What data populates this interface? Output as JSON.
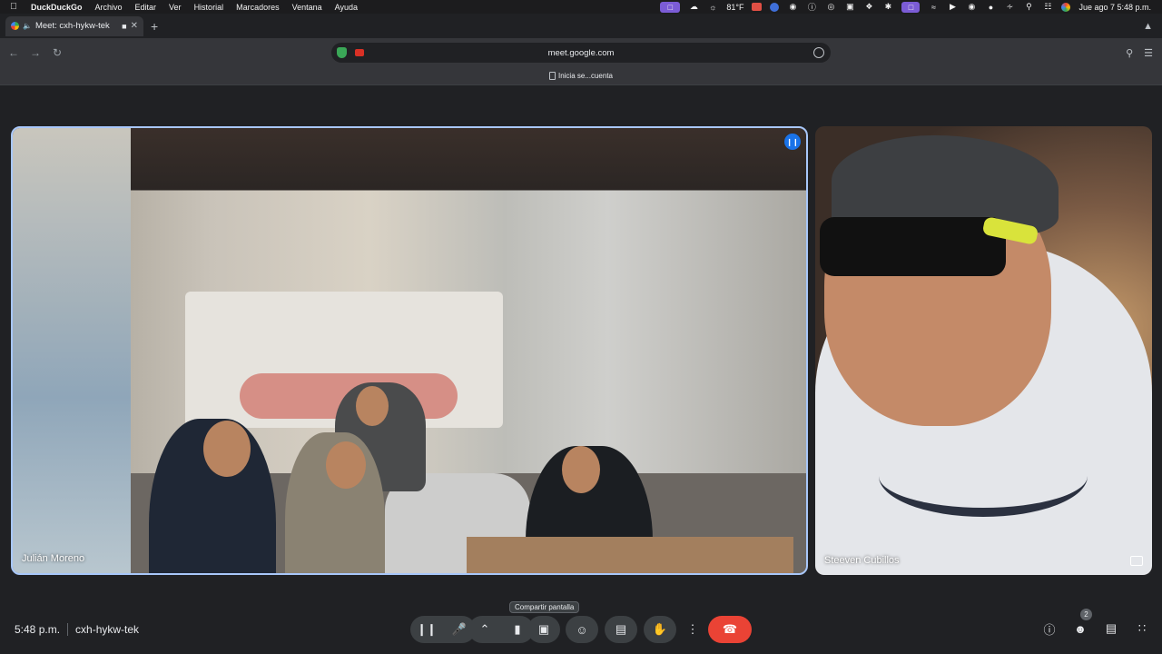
{
  "menubar": {
    "app": "DuckDuckGo",
    "items": [
      "Archivo",
      "Editar",
      "Ver",
      "Historial",
      "Marcadores",
      "Ventana",
      "Ayuda"
    ],
    "temperature": "81°F",
    "clock": "Jue ago 7  5:48 p.m."
  },
  "tab": {
    "title": "Meet: cxh-hykw-tek"
  },
  "address": {
    "url": "meet.google.com"
  },
  "bookmarks": {
    "item": "Inicia se...cuenta"
  },
  "participants": [
    {
      "name": "Julián Moreno"
    },
    {
      "name": "Steeven Cubillos"
    }
  ],
  "bottom": {
    "time": "5:48 p.m.",
    "meeting_code": "cxh-hykw-tek",
    "tooltip": "Compartir pantalla",
    "people_count": "2"
  },
  "colors": {
    "end_call": "#ea4335",
    "active_border": "#a8c7fa",
    "speaking": "#1a73e8"
  }
}
